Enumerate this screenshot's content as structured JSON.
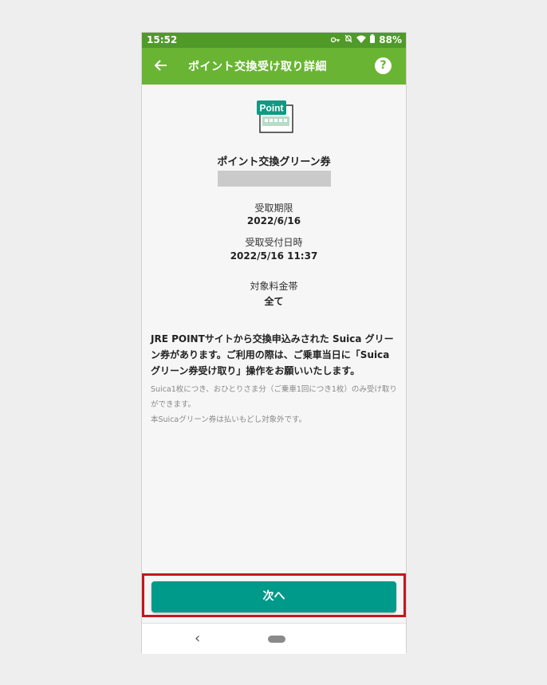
{
  "status_bar": {
    "time": "15:52",
    "battery": "88%",
    "icons": [
      "key-icon",
      "bell-off-icon",
      "wifi-icon",
      "battery-icon"
    ]
  },
  "app_bar": {
    "title": "ポイント交換受け取り詳細",
    "help_label": "?"
  },
  "ticket": {
    "badge_text": "Point",
    "title": "ポイント交換グリーン券"
  },
  "fields": [
    {
      "label": "受取期限",
      "value": "2022/6/16"
    },
    {
      "label": "受取受付日時",
      "value": "2022/5/16 11:37"
    },
    {
      "label": "対象料金帯",
      "value": "全て"
    }
  ],
  "notice": {
    "main": "JRE POINTサイトから交換申込みされた Suica グリーン券があります。ご利用の際は、ご乗車当日に「Suica グリーン券受け取り」操作をお願いいたします。",
    "sub_1": "Suica1枚につき、おひとりさま分（ご乗車1回につき1枚）のみ受け取りができます。",
    "sub_2": "本Suicaグリーン券は払いもどし対象外です。"
  },
  "footer": {
    "next_label": "次へ"
  },
  "nav": {
    "back_glyph": "‹"
  },
  "colors": {
    "status_bar": "#4f9a29",
    "app_bar": "#69b533",
    "next_button": "#009a8a",
    "highlight": "#c4161c"
  }
}
